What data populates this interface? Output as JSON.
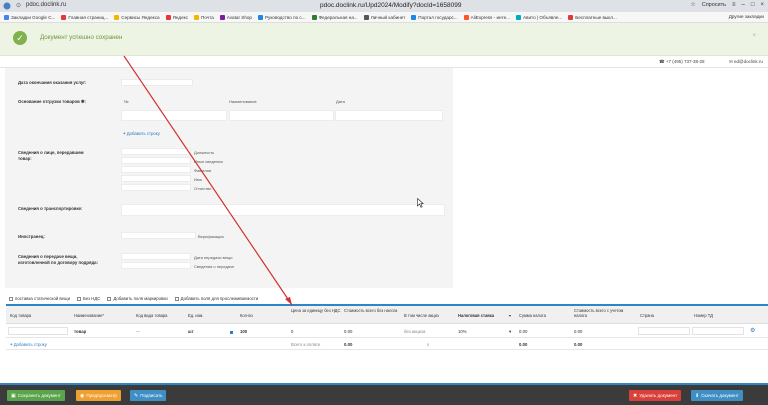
{
  "browser": {
    "host": "pdoc.doclink.ru",
    "page_title": "pdoc.doclink.ru/Upd2024/Modify?docId=1658099",
    "ask_label": "Спросить",
    "bookmarks": [
      {
        "label": "Закладки Google C...",
        "color": "#4285f4"
      },
      {
        "label": "Главная страниц...",
        "color": "#e53935"
      },
      {
        "label": "Сервисы Яндекса",
        "color": "#f4b400"
      },
      {
        "label": "Яндекс",
        "color": "#e53935"
      },
      {
        "label": "Почта",
        "color": "#f4b400"
      },
      {
        "label": "Avatar Shop",
        "color": "#7b1fa2"
      },
      {
        "label": "Руководство по с...",
        "color": "#1e88e5"
      },
      {
        "label": "Федеральная на...",
        "color": "#2e7d32"
      },
      {
        "label": "Личный кабинет",
        "color": "#555555"
      },
      {
        "label": "Портал государс...",
        "color": "#1e88e5"
      },
      {
        "label": "AliExpress - инте...",
        "color": "#ff5722"
      },
      {
        "label": "Авито | Объявле...",
        "color": "#00acc1"
      },
      {
        "label": "Бесплатные выкл...",
        "color": "#e53935"
      }
    ],
    "other_bookmarks": "Другие закладки"
  },
  "notification": {
    "text": "Документ успешно сохранен",
    "close": "×"
  },
  "contacts": {
    "phone": "+7 (495) 737-38-28",
    "email": "ed@doclink.ru"
  },
  "form": {
    "service_end_date_label": "Дата окончания оказания услуг:",
    "shipment_basis_label": "Основание отгрузки товаров ✱:",
    "basis_cols": [
      "№",
      "Наименование",
      "Дата"
    ],
    "add_row_label": "Добавить строку",
    "transfer_person_label": "Сведения о лице, передавшем товар:",
    "person_fields": [
      "Должность",
      "Иные сведения",
      "Фамилия",
      "Имя",
      "Отчество"
    ],
    "transport_label": "Сведения о транспортировке:",
    "other_label": "Иностранец:",
    "other_field": "Верификация",
    "transfer_info_label": "Сведения о передаче вещи, изготовленной по договору подряда:",
    "transfer_fields": [
      "Дата передачи вещи",
      "Сведения о передаче"
    ]
  },
  "checks": [
    "поставка статической вещи",
    "Без НДС",
    "Добавить поля маркировки",
    "Добавить поля для прослеживаемости"
  ],
  "table": {
    "headers": [
      "Код товара",
      "Наименование*",
      "Код вида товара",
      "Ед. изм.",
      "Кол-во",
      "Цена за единицу без НДС",
      "Стоимость всего без налога",
      "В том числе акциз",
      "Налоговая ставка",
      "Сумма налога",
      "Стоимость всего с учетом налога",
      "Страна",
      "Номер ТД"
    ],
    "row": {
      "name": "товар",
      "kind_code": "—",
      "unit": "шт",
      "qty": "100",
      "price": "0",
      "total_no_tax": "0.00",
      "excise": "без акциза",
      "tax_rate": "10%",
      "tax_sum": "0.00",
      "total_with_tax": "0.00"
    },
    "footer": {
      "add_row": "Добавить строку",
      "total_label": "Всего к оплате",
      "total_no_tax": "0.00",
      "excise": "х",
      "tax_sum": "0.00",
      "total_with_tax": "0.00"
    }
  },
  "buttons": {
    "save": "Сохранить документ",
    "preview": "Предпросмотр",
    "sign": "Подписать",
    "delete": "Удалить документ",
    "download": "Скачать документ"
  },
  "colors": {
    "accent": "#2e86c7",
    "success": "#7fb24c",
    "save_btn": "#5aa54b",
    "preview_btn": "#f0a030",
    "sign_btn": "#3f8fc4",
    "delete_btn": "#d9403a",
    "download_btn": "#3f8fc4"
  }
}
